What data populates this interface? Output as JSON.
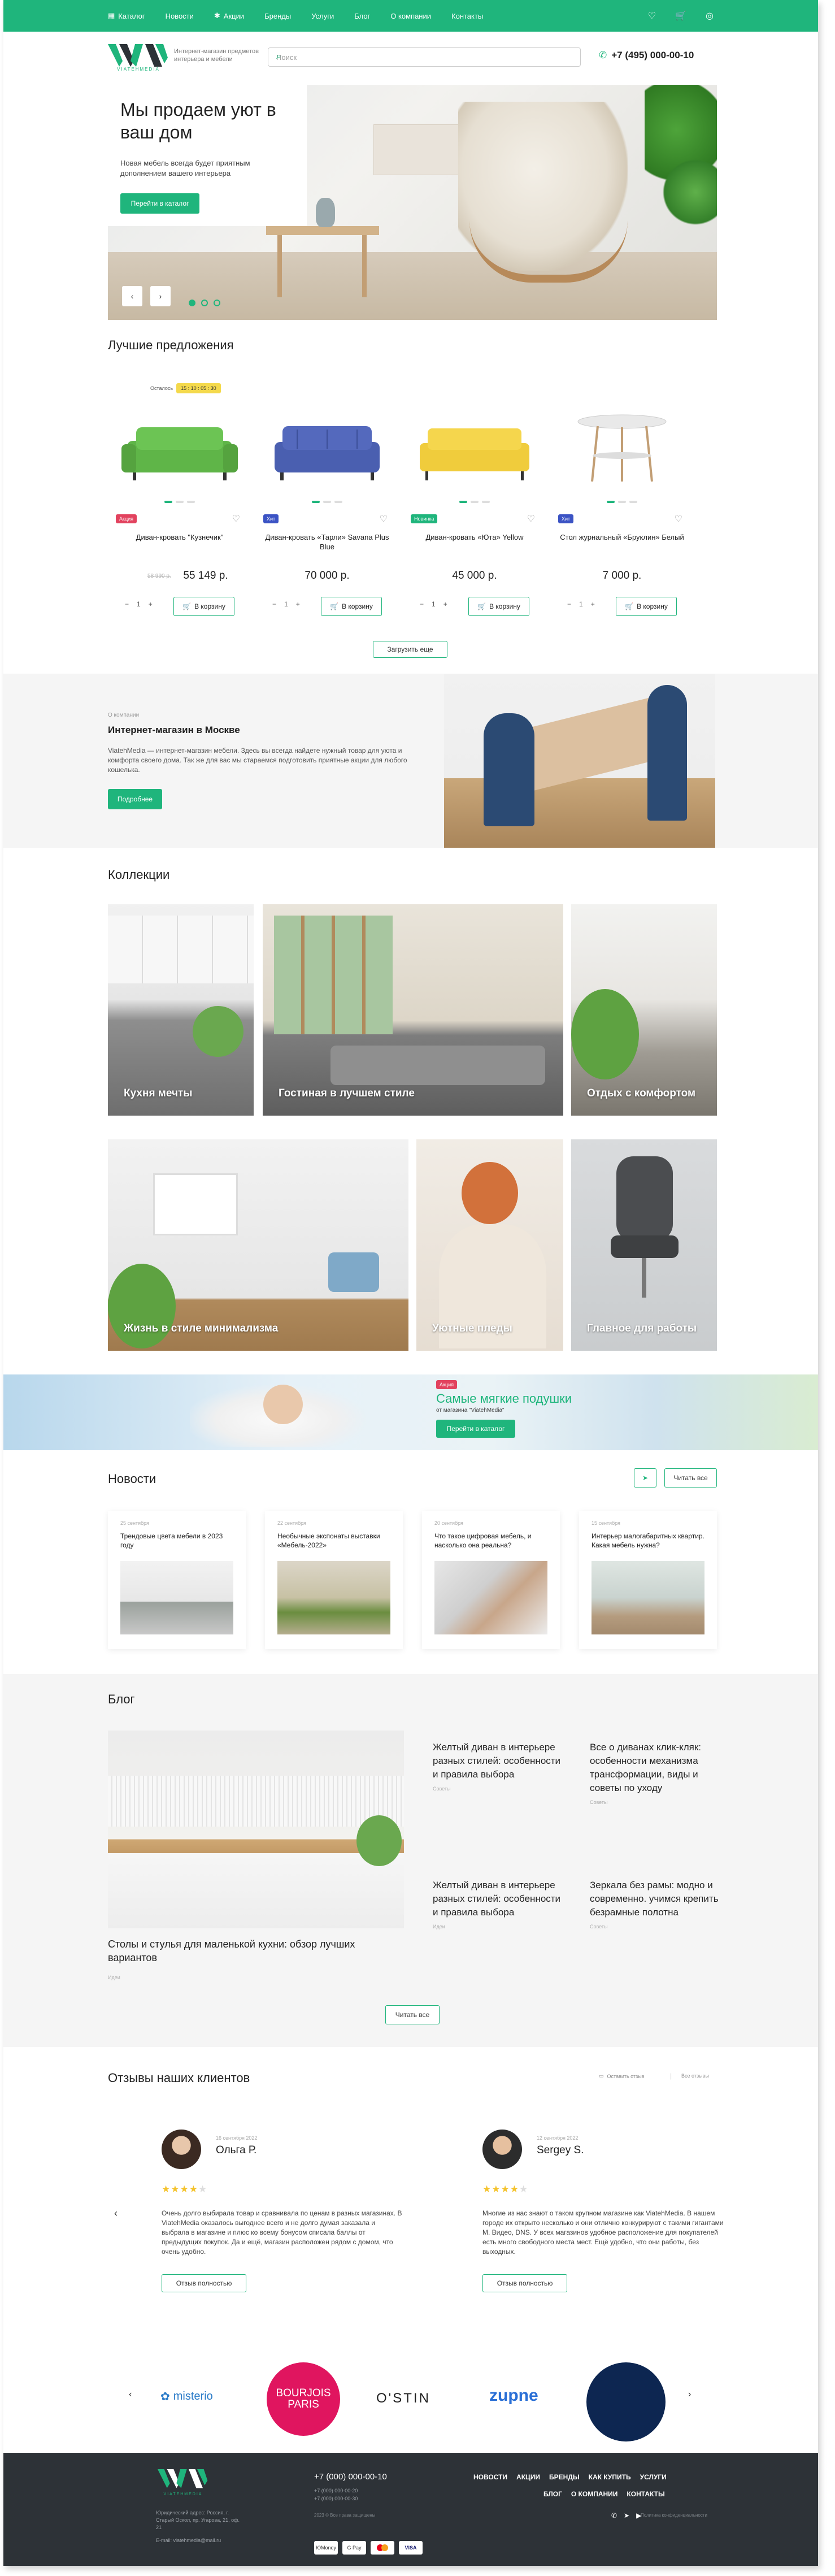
{
  "topnav": {
    "items": [
      "Каталог",
      "Новости",
      "Акции",
      "Бренды",
      "Услуги",
      "Блог",
      "О компании",
      "Контакты"
    ]
  },
  "header": {
    "brand": "VIATEHMEDIA",
    "tagline": "Интернет-магазин предметов интерьера и мебели",
    "search_placeholder": "Поиск",
    "phone": "+7 (495) 000-00-10"
  },
  "hero": {
    "title": "Мы продаем уют в ваш дом",
    "text": "Новая мебель всегда будет приятным дополнением вашего интерьера",
    "button": "Перейти в каталог",
    "slides": 3,
    "active_slide": 1
  },
  "offers": {
    "title": "Лучшие предложения",
    "timer_label": "Осталось",
    "timer": [
      "15",
      "10",
      "05",
      "30"
    ],
    "show_more": "Загрузить еще",
    "products": [
      {
        "badge": "Акция",
        "badge_color": "#e2425e",
        "name": "Диван-кровать \"Кузнечик\"",
        "old_price": "58 990 р.",
        "price": "55 149 р.",
        "qty": "1",
        "cart": "В корзину",
        "color": "#5fb548"
      },
      {
        "badge": "Хит",
        "badge_color": "#3b53c4",
        "name": "Диван-кровать «Тарли» Savana Plus Blue",
        "old_price": "",
        "price": "70 000 р.",
        "qty": "1",
        "cart": "В корзину",
        "color": "#4a5fb0"
      },
      {
        "badge": "Новинка",
        "badge_color": "#1fb57c",
        "name": "Диван-кровать «Юта» Yellow",
        "old_price": "",
        "price": "45 000 р.",
        "qty": "1",
        "cart": "В корзину",
        "color": "#f0cc3c"
      },
      {
        "badge": "Хит",
        "badge_color": "#3b53c4",
        "name": "Стол журнальный «Бруклин» Белый",
        "old_price": "",
        "price": "7 000 р.",
        "qty": "1",
        "cart": "В корзину",
        "color": "#e9e9e9"
      }
    ]
  },
  "about": {
    "kicker": "О компании",
    "title": "Интернет-магазин в Москве",
    "text": "ViatehMedia — интернет-магазин мебели. Здесь вы всегда найдете нужный товар для уюта и комфорта своего дома. Так же для вас мы стараемся подготовить приятные акции для любого кошелька.",
    "button": "Подробнее"
  },
  "collections": {
    "title": "Коллекции",
    "items": [
      "Кухня мечты",
      "Гостиная в лучшем стиле",
      "Отдых с комфортом",
      "Жизнь в стиле минимализма",
      "Уютные пледы",
      "Главное для работы"
    ]
  },
  "promo": {
    "tag": "Акция",
    "title": "Самые мягкие подушки",
    "subtitle": "от магазина \"ViatehMedia\"",
    "button": "Перейти в каталог"
  },
  "news": {
    "title": "Новости",
    "read_all": "Читать все",
    "items": [
      {
        "date": "25 сентября",
        "title": "Трендовые цвета мебели в 2023 году"
      },
      {
        "date": "22 сентября",
        "title": "Необычные экспонаты выставки «Мебель-2022»"
      },
      {
        "date": "20 сентября",
        "title": "Что такое цифровая мебель, и насколько она реальна?"
      },
      {
        "date": "15 сентября",
        "title": "Интерьер малогабаритных квартир. Какая мебель нужна?"
      }
    ]
  },
  "blog": {
    "title": "Блог",
    "main_title": "Столы и стулья для маленькой кухни: обзор лучших вариантов",
    "main_date": "Идеи",
    "items": [
      {
        "title": "Желтый диван в интерьере разных стилей: особенности и правила выбора",
        "date": "Советы"
      },
      {
        "title": "Все о диванах клик-кляк: особенности механизма трансформации, виды и советы по уходу",
        "date": "Советы"
      },
      {
        "title": "Желтый диван в интерьере разных стилей: особенности и правила выбора",
        "date": "Идеи"
      },
      {
        "title": "Зеркала без рамы: модно и современно. учимся крепить безрамные полотна",
        "date": "Советы"
      }
    ],
    "button": "Читать все"
  },
  "reviews": {
    "title": "Отзывы наших клиентов",
    "leave": "Оставить отзыв",
    "all": "Все отзывы",
    "more": "Отзыв полностью",
    "items": [
      {
        "date": "16 сентября 2022",
        "name": "Ольга Р.",
        "stars": 4,
        "text": "Очень долго выбирала товар и сравнивала по ценам в разных магазинах. В ViatehMedia оказалось выгоднее всего и не долго думая заказала и выбрала в магазине и плюс ко всему бонусом списала баллы от предыдущих покупок. Да и ещё, магазин расположен рядом с домом, что очень удобно."
      },
      {
        "date": "12 сентября 2022",
        "name": "Sergey S.",
        "stars": 4,
        "text": "Многие из нас знают о таком крупном магазине как ViatehMedia. В нашем городе их открыто несколько и они отлично конкурируют с такими гигантами М. Видео, DNS. У всех магазинов удобное расположение для покупателей есть много свободного места мест. Ещё удобно, что они работы, без выходных."
      }
    ]
  },
  "brands": [
    "misterio",
    "BOURJOIS PARIS",
    "O'STIN",
    "zupne",
    ""
  ],
  "footer": {
    "brand": "VIATEHMEDIA",
    "address": "Юридический адрес: Россия, г. Старый Оскол, пр. Угарова, 21, оф. 21",
    "email": "E-mail: viatehmedia@mail.ru",
    "phone": "+7 (000) 000-00-10",
    "phones": [
      "+7 (000) 000-00-20",
      "+7 (000) 000-00-30"
    ],
    "links_row1": [
      "Новости",
      "Акции",
      "Бренды",
      "Как купить",
      "Услуги"
    ],
    "links_row2": [
      "Блог",
      "О компании",
      "Контакты"
    ],
    "copyright": "2023 © Все права защищены",
    "policy": "Политика конфиденциальности",
    "payments": [
      "ЮMoney",
      "G Pay",
      "MC",
      "VISA"
    ]
  },
  "colors": {
    "accent": "#1fb57c",
    "footer": "#2d3237",
    "sale": "#e2425e"
  }
}
